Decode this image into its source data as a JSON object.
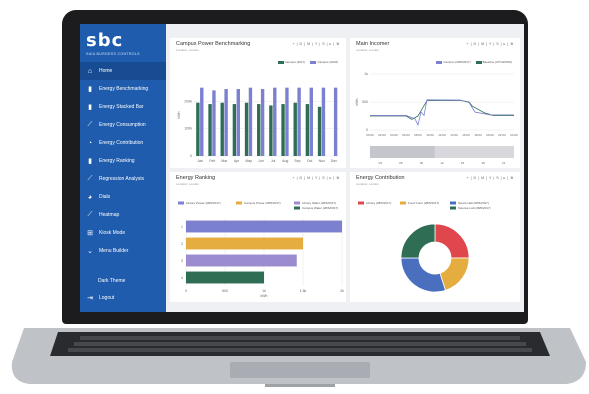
{
  "app": {
    "logo": "sbc",
    "logo_sub": "SAIA BURGESS CONTROLS"
  },
  "sidebar": {
    "items": [
      {
        "label": "Home",
        "icon": "home-icon",
        "glyph": "⌂"
      },
      {
        "label": "Energy Benchmarking",
        "icon": "bar-chart-icon",
        "glyph": "▮"
      },
      {
        "label": "Energy Stacked Bar",
        "icon": "bar-chart-icon",
        "glyph": "▮"
      },
      {
        "label": "Energy Consumption",
        "icon": "line-chart-icon",
        "glyph": "⟋"
      },
      {
        "label": "Energy Contribution",
        "icon": "donut-icon",
        "glyph": "◔"
      },
      {
        "label": "Energy Ranking",
        "icon": "bar-chart-icon",
        "glyph": "▮"
      },
      {
        "label": "Regression Analysis",
        "icon": "line-chart-icon",
        "glyph": "⟋"
      },
      {
        "label": "Dials",
        "icon": "dial-icon",
        "glyph": "◕"
      },
      {
        "label": "Heatmap",
        "icon": "line-chart-icon",
        "glyph": "⟋"
      },
      {
        "label": "Kiosk Mode",
        "icon": "kiosk-icon",
        "glyph": "⊞"
      },
      {
        "label": "Menu Builder",
        "icon": "chevron-down-icon",
        "glyph": "⌄"
      }
    ],
    "theme_label": "Dark Theme",
    "logout_label": "Logout"
  },
  "toolbar_text": "+ | D | M | Y | S | ▸ | ⚙",
  "colors": {
    "blue": "#7b80cf",
    "green": "#2f6e55",
    "orange": "#e5ad3f",
    "purple": "#9a8ccf",
    "red": "#e0474c",
    "navy": "#4a6fbf"
  },
  "chart_data": [
    {
      "type": "bar",
      "title": "Campus Power Benchmarking",
      "subtitle": "Location: London",
      "ylabel": "kWh",
      "categories": [
        "Jan",
        "Feb",
        "Mar",
        "Apr",
        "May",
        "Jun",
        "Jul",
        "Aug",
        "Sep",
        "Oct",
        "Nov",
        "Dec"
      ],
      "ylim": [
        0,
        300
      ],
      "yticks": [
        "0",
        "100k",
        "200k"
      ],
      "series": [
        {
          "name": "Campus (2017)",
          "color": "#2f6e55",
          "values": [
            195,
            190,
            195,
            190,
            195,
            190,
            185,
            190,
            195,
            190,
            180,
            0
          ]
        },
        {
          "name": "Campus (2018)",
          "color": "#7b80cf",
          "values": [
            250,
            240,
            245,
            245,
            250,
            245,
            250,
            250,
            250,
            250,
            250,
            250
          ]
        }
      ]
    },
    {
      "type": "line",
      "title": "Main Incomer",
      "subtitle": "Location: London",
      "ylabel": "kWh",
      "series": [
        {
          "name": "Campus (28/6/2017)",
          "color": "#7b80cf"
        },
        {
          "name": "Baseline (27/10/2016)",
          "color": "#2f6e55"
        }
      ],
      "xticks": [
        "00:00",
        "02:00",
        "04:00",
        "06:00",
        "08:00",
        "10:00",
        "12:00",
        "14:00",
        "16:00",
        "18:00",
        "20:00",
        "22:00",
        "24:00"
      ],
      "yticks": [
        "0",
        "500",
        "1k"
      ],
      "nav_ticks": [
        "03",
        "06",
        "09",
        "12",
        "15",
        "18",
        "21"
      ]
    },
    {
      "type": "bar",
      "title": "Energy Ranking",
      "subtitle": "Location: London",
      "xlabel": "kWh",
      "categories": [
        "1",
        "2",
        "3",
        "4"
      ],
      "xticks": [
        "0",
        "500",
        "1k",
        "1.5k",
        "2k"
      ],
      "series": [
        {
          "name": "Library Power (28/6/2017)",
          "color": "#7b80cf",
          "value": 2000
        },
        {
          "name": "Campus Power (28/6/2017)",
          "color": "#e5ad3f",
          "value": 1500
        },
        {
          "name": "Library Water (28/6/2017)",
          "color": "#9a8ccf",
          "value": 1420
        },
        {
          "name": "Campus Water (28/6/2017)",
          "color": "#2f6e55",
          "value": 1000
        }
      ]
    },
    {
      "type": "pie",
      "title": "Energy Contribution",
      "subtitle": "Location: London",
      "slices": [
        {
          "name": "Library (28/6/2017)",
          "color": "#e0474c",
          "value": 25
        },
        {
          "name": "Food Court (28/6/2017)",
          "color": "#e5ad3f",
          "value": 20
        },
        {
          "name": "Sports Hall (28/6/2017)",
          "color": "#4a6fbf",
          "value": 30
        },
        {
          "name": "Science Lab (28/6/2017)",
          "color": "#2f6e55",
          "value": 25
        }
      ]
    }
  ]
}
